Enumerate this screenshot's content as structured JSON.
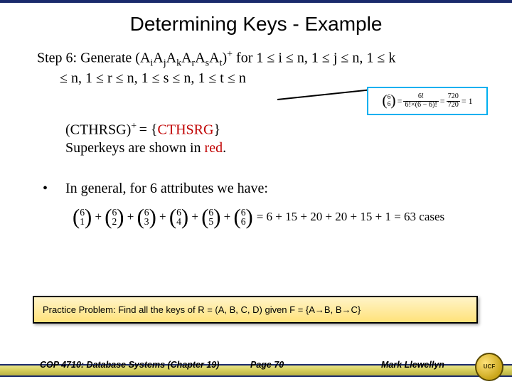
{
  "title": "Determining Keys - Example",
  "step6_line1_prefix": "Step 6: Generate (A",
  "step6_line1_rest": " for 1 ≤ i ≤ n, 1 ≤ j ≤ n, 1 ≤ k",
  "step6_line2": "≤ n, 1 ≤ r ≤ n, 1 ≤ s ≤ n, 1 ≤ t ≤ n",
  "callout": {
    "n": "6",
    "k": "6",
    "eq1": "=",
    "num1": "6!",
    "den1": "6!×(6 − 6)!",
    "eq2": "=",
    "num2": "720",
    "den2": "720",
    "eq3": "= 1"
  },
  "closure_lhs": "(CTHRSG)",
  "closure_sup": "+ ",
  "closure_eq": "=  {",
  "closure_rhs": "CTHSRG",
  "closure_close": "}",
  "superkeys_line": "Superkeys are shown in ",
  "superkeys_red": "red",
  "superkeys_period": ".",
  "bullet_text": "In general, for 6 attributes we have:",
  "combo": {
    "n": "6",
    "ks": [
      "1",
      "2",
      "3",
      "4",
      "5",
      "6"
    ],
    "rhs": "= 6 + 15 + 20 + 20 + 15 + 1 = 63  cases"
  },
  "practice": "Practice Problem:  Find all the keys of R = (A, B, C, D) given F = {A→B, B→C}",
  "footer": {
    "left": "COP 4710: Database Systems  (Chapter 19)",
    "mid": "Page 70",
    "right": "Mark Llewellyn"
  },
  "logo_text": "UCF"
}
